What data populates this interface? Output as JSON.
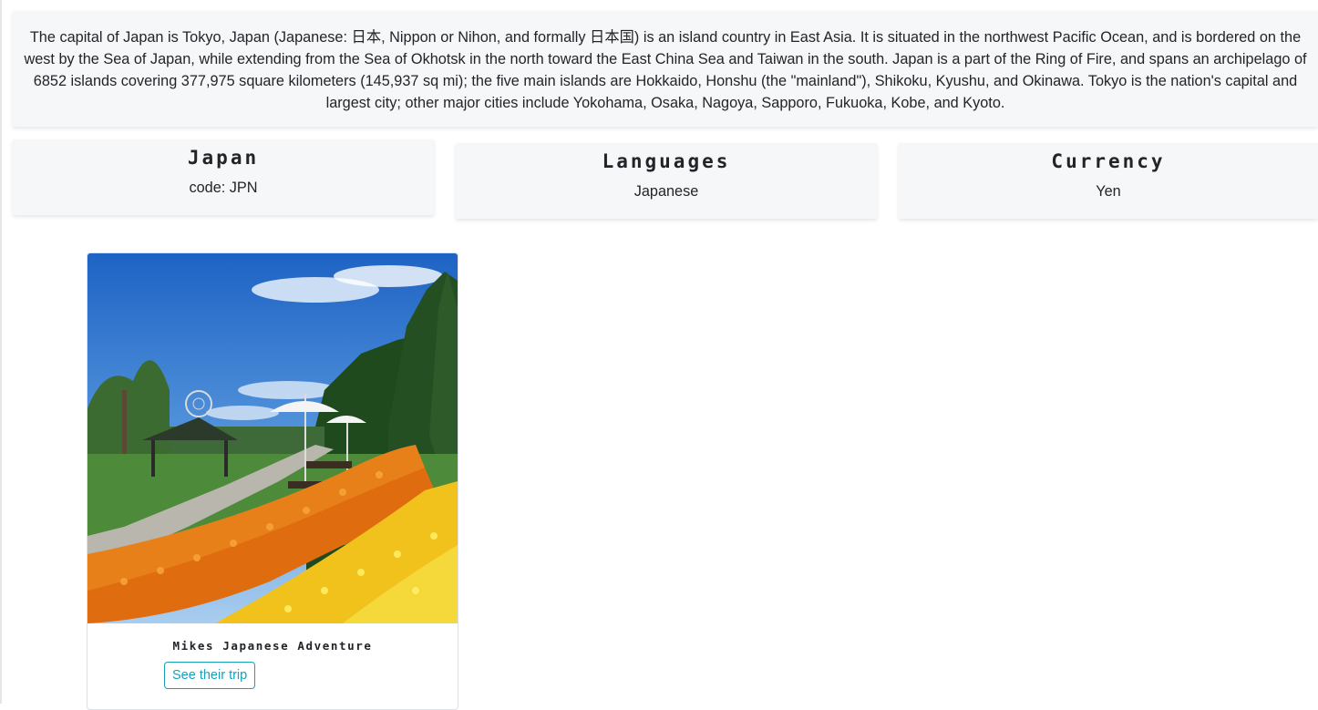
{
  "country": {
    "description": "The capital of Japan is Tokyo, Japan (Japanese: 日本, Nippon or Nihon, and formally 日本国) is an island country in East Asia. It is situated in the northwest Pacific Ocean, and is bordered on the west by the Sea of Japan, while extending from the Sea of Okhotsk in the north toward the East China Sea and Taiwan in the south. Japan is a part of the Ring of Fire, and spans an archipelago of 6852 islands covering 377,975 square kilometers (145,937 sq mi); the five main islands are Hokkaido, Honshu (the \"mainland\"), Shikoku, Kyushu, and Okinawa. Tokyo is the nation's capital and largest city; other major cities include Yokohama, Osaka, Nagoya, Sapporo, Fukuoka, Kobe, and Kyoto.",
    "name": "Japan",
    "code_text": "code: JPN"
  },
  "languages": {
    "title": "Languages",
    "value": "Japanese"
  },
  "currency": {
    "title": "Currency",
    "value": "Yen"
  },
  "trips": [
    {
      "image_icon": "garden-flowers-photo",
      "title": "Mikes Japanese Adventure",
      "button_label": "See their trip"
    }
  ],
  "colors": {
    "panel_bg": "#f6f7f9",
    "accent": "#17a2b8",
    "text": "#212529"
  }
}
